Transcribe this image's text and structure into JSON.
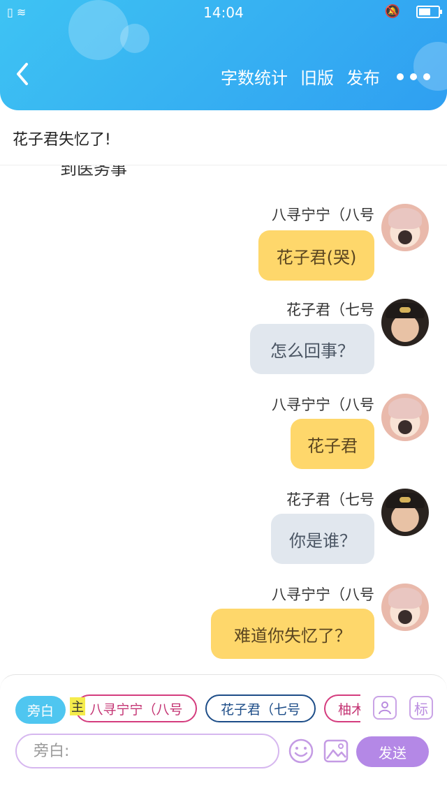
{
  "status_bar": {
    "time": "14:04",
    "battery_level": 0.6
  },
  "nav": {
    "word_count": "字数统计",
    "old_version": "旧版",
    "publish": "发布"
  },
  "story_title": "花子君失忆了!",
  "chat": {
    "partial_text": "到医务事",
    "messages": [
      {
        "name": "八寻宁宁（八号",
        "text": "花子君(哭)",
        "style": "yellow",
        "avatar": "nene-avatar"
      },
      {
        "name": "花子君（七号",
        "text": "怎么回事？",
        "style": "gray",
        "avatar": "hanako-avatar"
      },
      {
        "name": "八寻宁宁（八号",
        "text": "花子君",
        "style": "yellow",
        "avatar": "nene-avatar"
      },
      {
        "name": "花子君（七号",
        "text": "你是谁？",
        "style": "gray",
        "avatar": "hanako-avatar"
      },
      {
        "name": "八寻宁宁（八号",
        "text": "难道你失忆了？",
        "style": "yellow",
        "avatar": "nene-avatar"
      }
    ]
  },
  "bottom": {
    "chips": {
      "narration": "旁白",
      "main_tag": "主",
      "nene": "八寻宁宁（八号",
      "hanako": "花子君（七号",
      "cut": "柚木"
    },
    "tag_icon": "标",
    "input_placeholder": "旁白:",
    "send": "发送"
  }
}
